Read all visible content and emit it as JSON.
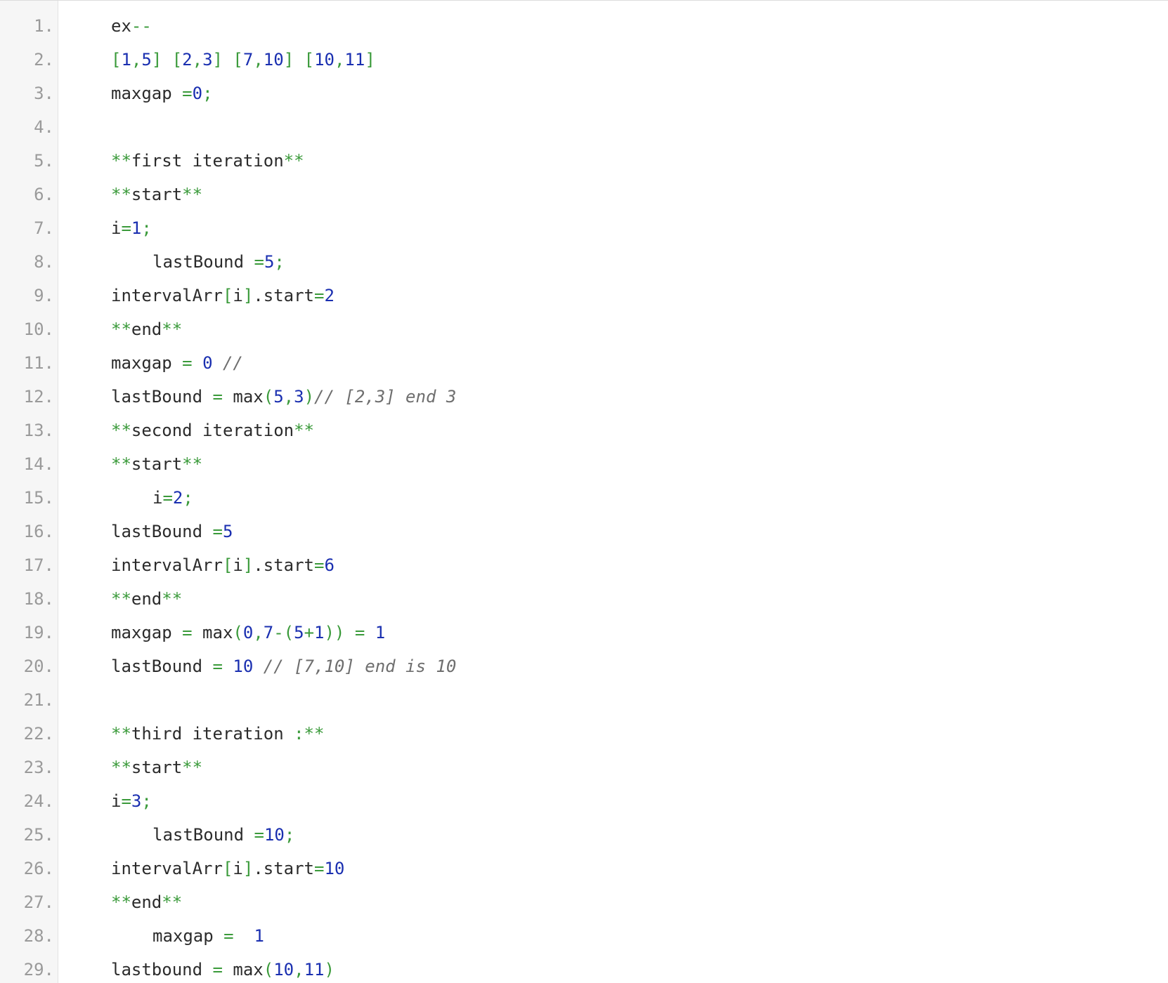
{
  "editor": {
    "colors": {
      "plain": "#2b2b2b",
      "operator": "#3a9a3a",
      "number": "#1a2fb0",
      "comment": "#6e6e6e",
      "line_number": "#9a9a9a",
      "gutter_bg": "#f6f6f6"
    },
    "lines": [
      {
        "n": "1.",
        "indent": false,
        "tokens": [
          {
            "t": "ex",
            "k": "p"
          },
          {
            "t": "--",
            "k": "o"
          }
        ]
      },
      {
        "n": "2.",
        "indent": false,
        "tokens": [
          {
            "t": "[",
            "k": "o"
          },
          {
            "t": "1",
            "k": "n"
          },
          {
            "t": ",",
            "k": "o"
          },
          {
            "t": "5",
            "k": "n"
          },
          {
            "t": "] [",
            "k": "o"
          },
          {
            "t": "2",
            "k": "n"
          },
          {
            "t": ",",
            "k": "o"
          },
          {
            "t": "3",
            "k": "n"
          },
          {
            "t": "] [",
            "k": "o"
          },
          {
            "t": "7",
            "k": "n"
          },
          {
            "t": ",",
            "k": "o"
          },
          {
            "t": "10",
            "k": "n"
          },
          {
            "t": "] [",
            "k": "o"
          },
          {
            "t": "10",
            "k": "n"
          },
          {
            "t": ",",
            "k": "o"
          },
          {
            "t": "11",
            "k": "n"
          },
          {
            "t": "]",
            "k": "o"
          }
        ]
      },
      {
        "n": "3.",
        "indent": false,
        "tokens": [
          {
            "t": "maxgap ",
            "k": "p"
          },
          {
            "t": "=",
            "k": "o"
          },
          {
            "t": "0",
            "k": "n"
          },
          {
            "t": ";",
            "k": "o"
          }
        ]
      },
      {
        "n": "4.",
        "indent": false,
        "tokens": []
      },
      {
        "n": "5.",
        "indent": false,
        "tokens": [
          {
            "t": "**",
            "k": "o"
          },
          {
            "t": "first iteration",
            "k": "p"
          },
          {
            "t": "**",
            "k": "o"
          }
        ]
      },
      {
        "n": "6.",
        "indent": false,
        "tokens": [
          {
            "t": "**",
            "k": "o"
          },
          {
            "t": "start",
            "k": "p"
          },
          {
            "t": "**",
            "k": "o"
          }
        ]
      },
      {
        "n": "7.",
        "indent": false,
        "tokens": [
          {
            "t": "i",
            "k": "p"
          },
          {
            "t": "=",
            "k": "o"
          },
          {
            "t": "1",
            "k": "n"
          },
          {
            "t": ";",
            "k": "o"
          }
        ]
      },
      {
        "n": "8.",
        "indent": true,
        "tokens": [
          {
            "t": "lastBound ",
            "k": "p"
          },
          {
            "t": "=",
            "k": "o"
          },
          {
            "t": "5",
            "k": "n"
          },
          {
            "t": ";",
            "k": "o"
          }
        ]
      },
      {
        "n": "9.",
        "indent": false,
        "tokens": [
          {
            "t": "intervalArr",
            "k": "p"
          },
          {
            "t": "[",
            "k": "o"
          },
          {
            "t": "i",
            "k": "p"
          },
          {
            "t": "]",
            "k": "o"
          },
          {
            "t": ".start",
            "k": "p"
          },
          {
            "t": "=",
            "k": "o"
          },
          {
            "t": "2",
            "k": "n"
          }
        ]
      },
      {
        "n": "10.",
        "indent": false,
        "tokens": [
          {
            "t": "**",
            "k": "o"
          },
          {
            "t": "end",
            "k": "p"
          },
          {
            "t": "**",
            "k": "o"
          }
        ]
      },
      {
        "n": "11.",
        "indent": false,
        "tokens": [
          {
            "t": "maxgap ",
            "k": "p"
          },
          {
            "t": "=",
            "k": "o"
          },
          {
            "t": " ",
            "k": "p"
          },
          {
            "t": "0",
            "k": "n"
          },
          {
            "t": " //",
            "k": "c"
          }
        ]
      },
      {
        "n": "12.",
        "indent": false,
        "tokens": [
          {
            "t": "lastBound ",
            "k": "p"
          },
          {
            "t": "=",
            "k": "o"
          },
          {
            "t": " max",
            "k": "p"
          },
          {
            "t": "(",
            "k": "o"
          },
          {
            "t": "5",
            "k": "n"
          },
          {
            "t": ",",
            "k": "o"
          },
          {
            "t": "3",
            "k": "n"
          },
          {
            "t": ")",
            "k": "o"
          },
          {
            "t": "// [2,3] end 3",
            "k": "c"
          }
        ]
      },
      {
        "n": "13.",
        "indent": false,
        "tokens": [
          {
            "t": "**",
            "k": "o"
          },
          {
            "t": "second iteration",
            "k": "p"
          },
          {
            "t": "**",
            "k": "o"
          }
        ]
      },
      {
        "n": "14.",
        "indent": false,
        "tokens": [
          {
            "t": "**",
            "k": "o"
          },
          {
            "t": "start",
            "k": "p"
          },
          {
            "t": "**",
            "k": "o"
          }
        ]
      },
      {
        "n": "15.",
        "indent": true,
        "tokens": [
          {
            "t": "i",
            "k": "p"
          },
          {
            "t": "=",
            "k": "o"
          },
          {
            "t": "2",
            "k": "n"
          },
          {
            "t": ";",
            "k": "o"
          }
        ]
      },
      {
        "n": "16.",
        "indent": false,
        "tokens": [
          {
            "t": "lastBound ",
            "k": "p"
          },
          {
            "t": "=",
            "k": "o"
          },
          {
            "t": "5",
            "k": "n"
          }
        ]
      },
      {
        "n": "17.",
        "indent": false,
        "tokens": [
          {
            "t": "intervalArr",
            "k": "p"
          },
          {
            "t": "[",
            "k": "o"
          },
          {
            "t": "i",
            "k": "p"
          },
          {
            "t": "]",
            "k": "o"
          },
          {
            "t": ".start",
            "k": "p"
          },
          {
            "t": "=",
            "k": "o"
          },
          {
            "t": "6",
            "k": "n"
          }
        ]
      },
      {
        "n": "18.",
        "indent": false,
        "tokens": [
          {
            "t": "**",
            "k": "o"
          },
          {
            "t": "end",
            "k": "p"
          },
          {
            "t": "**",
            "k": "o"
          }
        ]
      },
      {
        "n": "19.",
        "indent": false,
        "tokens": [
          {
            "t": "maxgap ",
            "k": "p"
          },
          {
            "t": "=",
            "k": "o"
          },
          {
            "t": " max",
            "k": "p"
          },
          {
            "t": "(",
            "k": "o"
          },
          {
            "t": "0",
            "k": "n"
          },
          {
            "t": ",",
            "k": "o"
          },
          {
            "t": "7",
            "k": "n"
          },
          {
            "t": "-(",
            "k": "o"
          },
          {
            "t": "5",
            "k": "n"
          },
          {
            "t": "+",
            "k": "o"
          },
          {
            "t": "1",
            "k": "n"
          },
          {
            "t": ")) = ",
            "k": "o"
          },
          {
            "t": "1",
            "k": "n"
          }
        ]
      },
      {
        "n": "20.",
        "indent": false,
        "tokens": [
          {
            "t": "lastBound ",
            "k": "p"
          },
          {
            "t": "=",
            "k": "o"
          },
          {
            "t": " ",
            "k": "p"
          },
          {
            "t": "10",
            "k": "n"
          },
          {
            "t": " // [7,10] end is 10",
            "k": "c"
          }
        ]
      },
      {
        "n": "21.",
        "indent": false,
        "tokens": []
      },
      {
        "n": "22.",
        "indent": false,
        "tokens": [
          {
            "t": "**",
            "k": "o"
          },
          {
            "t": "third iteration ",
            "k": "p"
          },
          {
            "t": ":**",
            "k": "o"
          }
        ]
      },
      {
        "n": "23.",
        "indent": false,
        "tokens": [
          {
            "t": "**",
            "k": "o"
          },
          {
            "t": "start",
            "k": "p"
          },
          {
            "t": "**",
            "k": "o"
          }
        ]
      },
      {
        "n": "24.",
        "indent": false,
        "tokens": [
          {
            "t": "i",
            "k": "p"
          },
          {
            "t": "=",
            "k": "o"
          },
          {
            "t": "3",
            "k": "n"
          },
          {
            "t": ";",
            "k": "o"
          }
        ]
      },
      {
        "n": "25.",
        "indent": true,
        "tokens": [
          {
            "t": "lastBound ",
            "k": "p"
          },
          {
            "t": "=",
            "k": "o"
          },
          {
            "t": "10",
            "k": "n"
          },
          {
            "t": ";",
            "k": "o"
          }
        ]
      },
      {
        "n": "26.",
        "indent": false,
        "tokens": [
          {
            "t": "intervalArr",
            "k": "p"
          },
          {
            "t": "[",
            "k": "o"
          },
          {
            "t": "i",
            "k": "p"
          },
          {
            "t": "]",
            "k": "o"
          },
          {
            "t": ".start",
            "k": "p"
          },
          {
            "t": "=",
            "k": "o"
          },
          {
            "t": "10",
            "k": "n"
          }
        ]
      },
      {
        "n": "27.",
        "indent": false,
        "tokens": [
          {
            "t": "**",
            "k": "o"
          },
          {
            "t": "end",
            "k": "p"
          },
          {
            "t": "**",
            "k": "o"
          }
        ]
      },
      {
        "n": "28.",
        "indent": true,
        "tokens": [
          {
            "t": "maxgap ",
            "k": "p"
          },
          {
            "t": "=",
            "k": "o"
          },
          {
            "t": "  ",
            "k": "p"
          },
          {
            "t": "1",
            "k": "n"
          }
        ]
      },
      {
        "n": "29.",
        "indent": false,
        "tokens": [
          {
            "t": "lastbound ",
            "k": "p"
          },
          {
            "t": "=",
            "k": "o"
          },
          {
            "t": " max",
            "k": "p"
          },
          {
            "t": "(",
            "k": "o"
          },
          {
            "t": "10",
            "k": "n"
          },
          {
            "t": ",",
            "k": "o"
          },
          {
            "t": "11",
            "k": "n"
          },
          {
            "t": ")",
            "k": "o"
          }
        ]
      }
    ]
  }
}
